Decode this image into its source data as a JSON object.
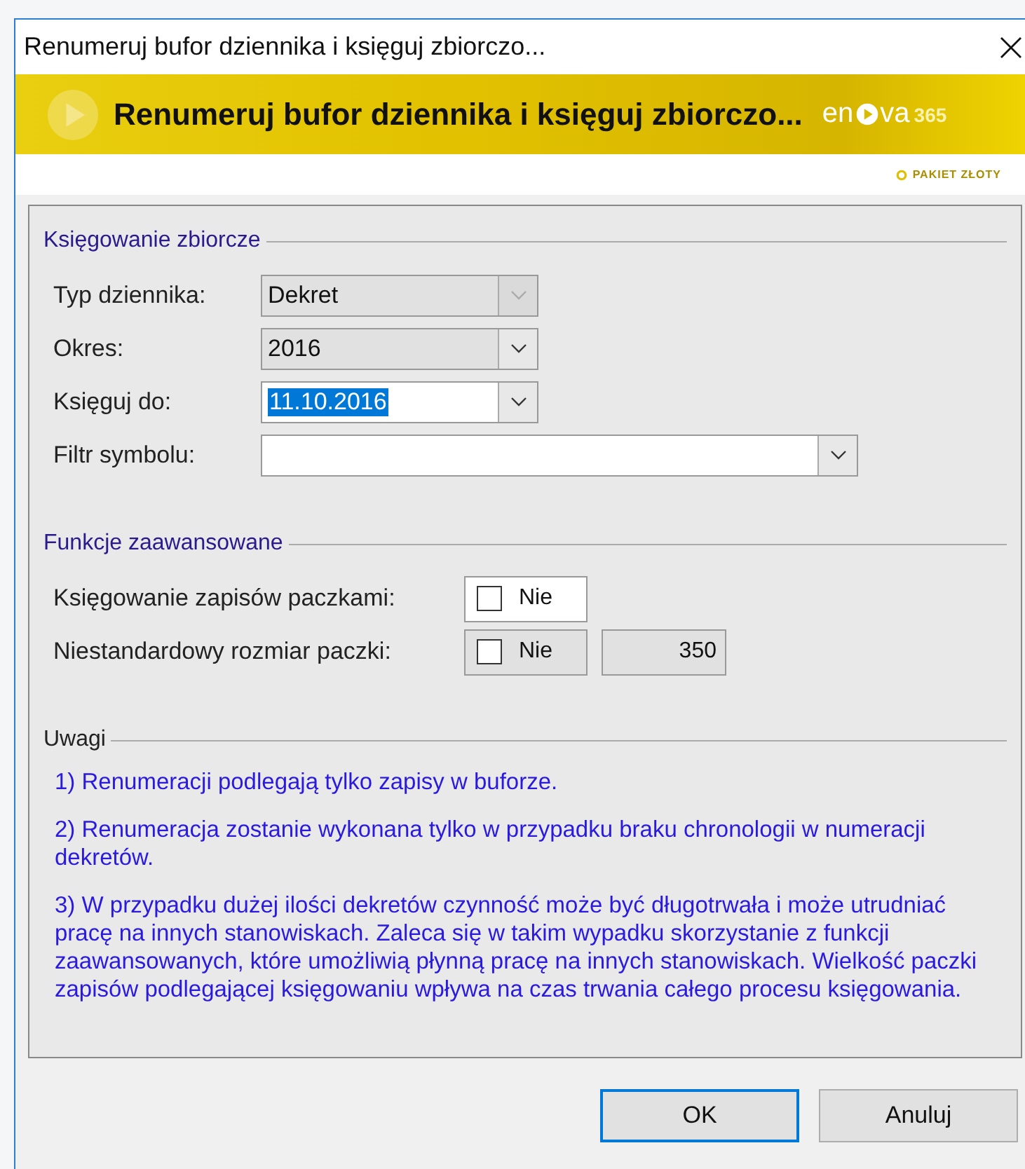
{
  "window": {
    "title": "Renumeruj bufor dziennika i księguj zbiorczo..."
  },
  "banner": {
    "title": "Renumeruj bufor dziennika i księguj zbiorczo...",
    "logo": "en",
    "logo_suffix": "va",
    "logo_number": "365",
    "package": "PAKIET ZŁOTY"
  },
  "groups": [
    {
      "kind": "fields",
      "title": "Księgowanie zbiorcze",
      "fields": [
        {
          "label": "Typ dziennika:",
          "value": "Dekret",
          "kind": "short",
          "editable": false,
          "disabled": true
        },
        {
          "label": "Okres:",
          "value": "2016",
          "kind": "short",
          "editable": false,
          "disabled": false
        },
        {
          "label": "Księguj do:",
          "value": "11.10.2016",
          "kind": "short",
          "editable": true,
          "disabled": false,
          "text_selected": true
        },
        {
          "label": "Filtr symbolu:",
          "kind": "long",
          "editable": true,
          "disabled": false
        }
      ]
    },
    {
      "kind": "options",
      "title": "Funkcje zaawansowane",
      "options": [
        {
          "label": "Księgowanie zapisów paczkami:",
          "value": "Nie",
          "checked": false,
          "disabled": false
        },
        {
          "label": "Niestandardowy rozmiar paczki:",
          "value": "Nie",
          "checked": false,
          "disabled": true,
          "number": "350"
        }
      ]
    },
    {
      "kind": "notes",
      "title": "Uwagi",
      "notes": [
        "1) Renumeracji podlegają tylko zapisy w buforze.",
        "2) Renumeracja zostanie wykonana tylko w przypadku braku chronologii w numeracji dekretów.",
        "3) W przypadku dużej ilości dekretów czynność może być długotrwała i może utrudniać pracę na innych stanowiskach. Zaleca się w takim wypadku skorzystanie z funkcji zaawansowanych, które umożliwią płynną pracę na innych stanowiskach. Wielkość paczki zapisów podlegającej księgowaniu wpływa na czas trwania całego procesu księgowania."
      ]
    }
  ],
  "buttons": [
    {
      "label": "OK",
      "default": true
    },
    {
      "label": "Anuluj",
      "default": false
    }
  ]
}
